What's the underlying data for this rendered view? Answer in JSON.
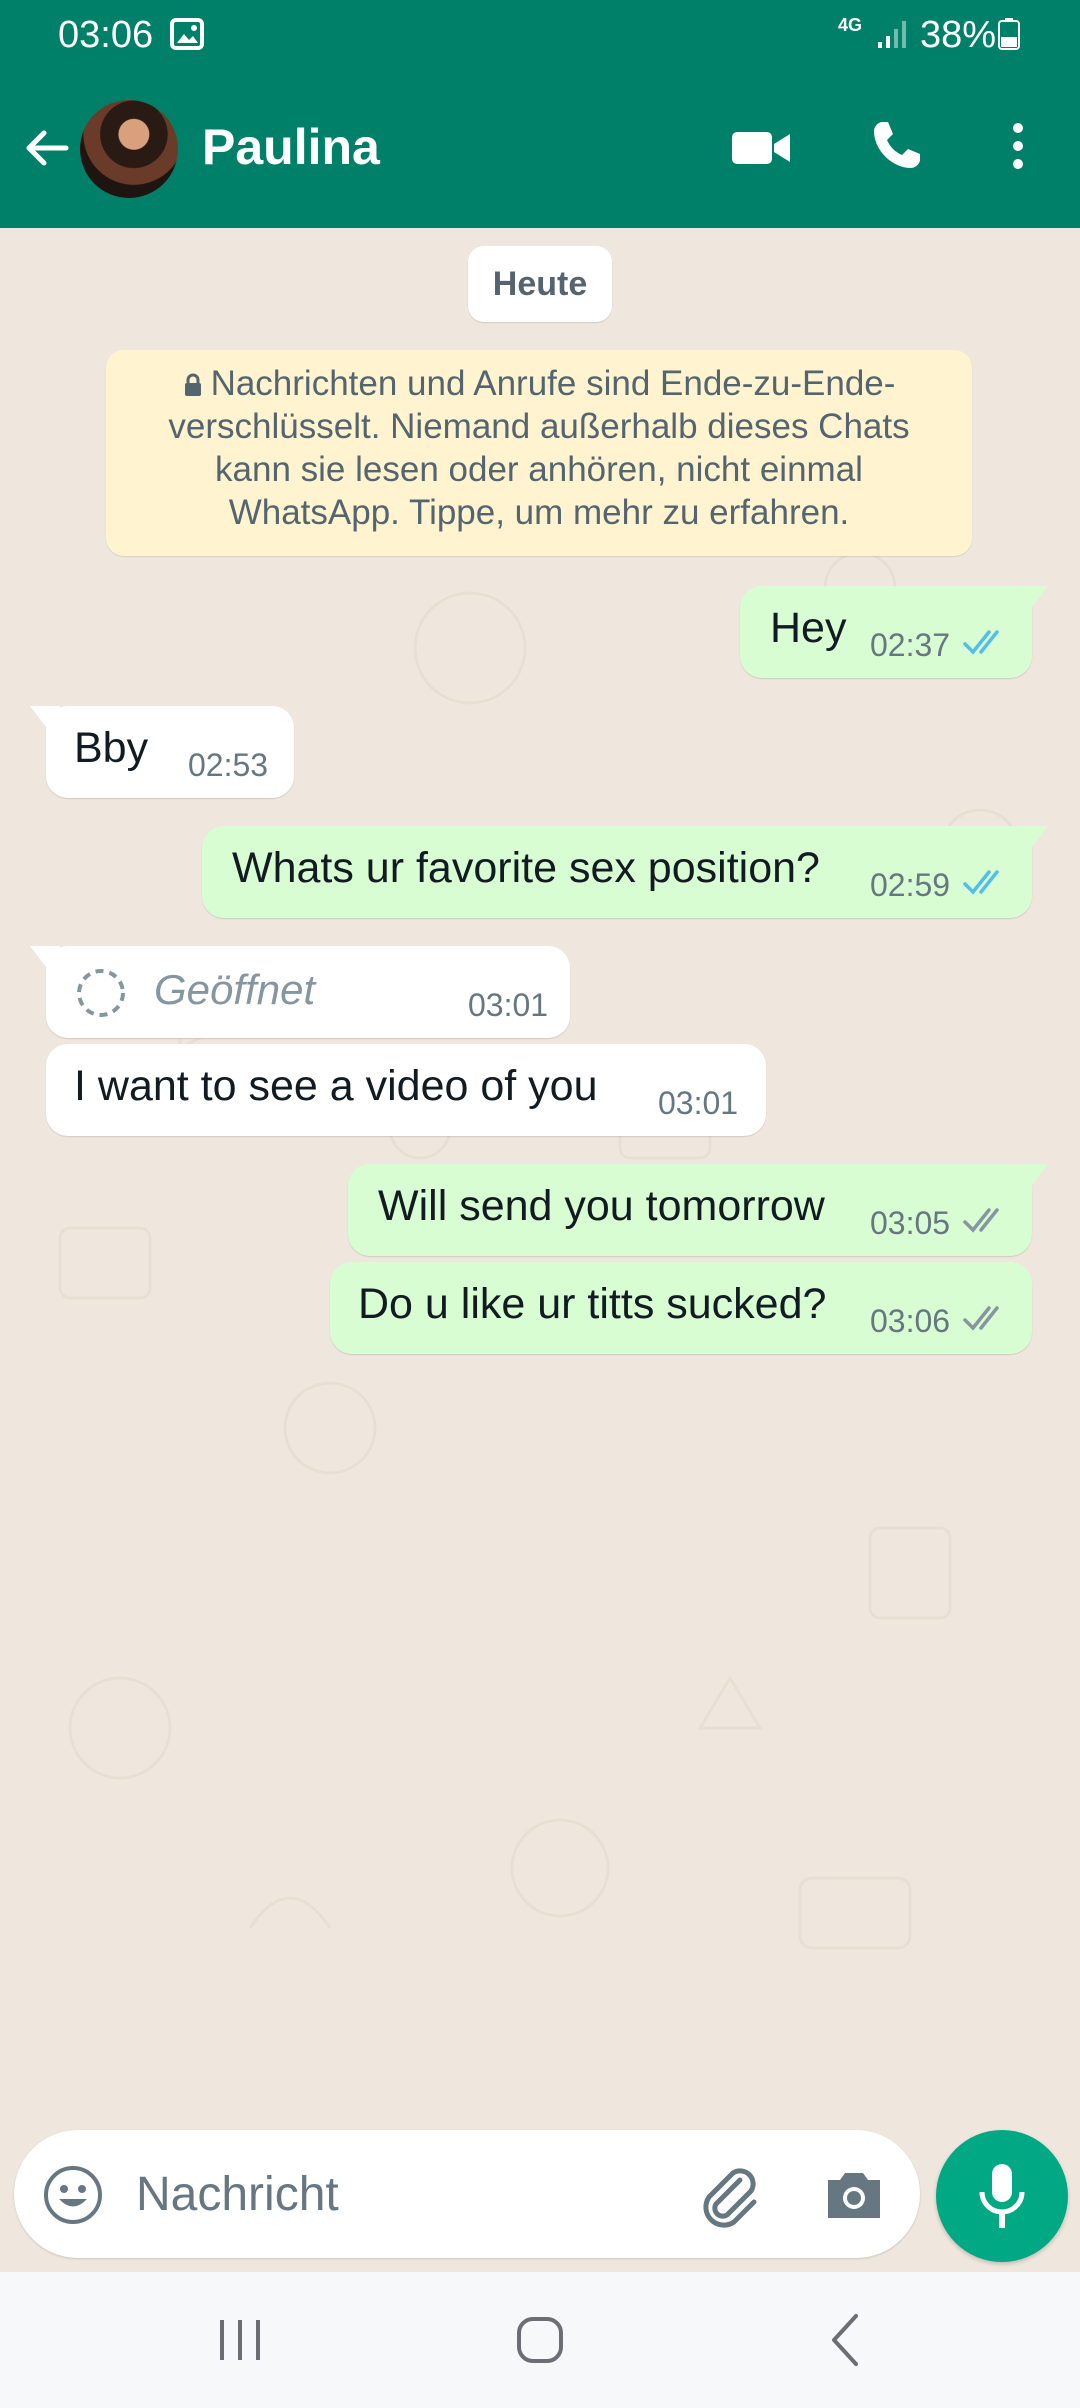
{
  "status_bar": {
    "time": "03:06",
    "network": "4G",
    "battery": "38%"
  },
  "header": {
    "contact_name": "Paulina"
  },
  "chat": {
    "date_chip": "Heute",
    "encryption_notice": "Nachrichten und Anrufe sind Ende-zu-Ende-verschlüsselt. Niemand außerhalb dieses Chats kann sie lesen oder anhören, nicht einmal WhatsApp. Tippe, um mehr zu erfahren.",
    "messages": [
      {
        "direction": "out",
        "text": "Hey",
        "time": "02:37",
        "status": "read"
      },
      {
        "direction": "in",
        "text": "Bby",
        "time": "02:53"
      },
      {
        "direction": "out",
        "text": "Whats ur favorite sex position?",
        "time": "02:59",
        "status": "read"
      },
      {
        "direction": "in",
        "text": "Geöffnet",
        "time": "03:01",
        "type": "view-once-opened"
      },
      {
        "direction": "in",
        "text": "I want to see a video of you",
        "time": "03:01"
      },
      {
        "direction": "out",
        "text": "Will send you tomorrow",
        "time": "03:05",
        "status": "delivered"
      },
      {
        "direction": "out",
        "text": "Do u like ur titts sucked?",
        "time": "03:06",
        "status": "delivered"
      }
    ]
  },
  "composer": {
    "placeholder": "Nachricht"
  },
  "colors": {
    "header": "#008069",
    "outgoing_bubble": "#d9fdd3",
    "incoming_bubble": "#ffffff",
    "read_ticks": "#53bdeb",
    "delivered_ticks": "#8696a0",
    "mic_button": "#00a884",
    "chat_background": "#efe7dd",
    "encryption_notice_bg": "#fff4cf"
  },
  "icons": {
    "back": "arrow-left-icon",
    "video_call": "video-camera-icon",
    "voice_call": "phone-icon",
    "menu": "more-vertical-icon",
    "emoji": "emoji-icon",
    "attach": "paperclip-icon",
    "camera": "camera-icon",
    "mic": "microphone-icon"
  }
}
